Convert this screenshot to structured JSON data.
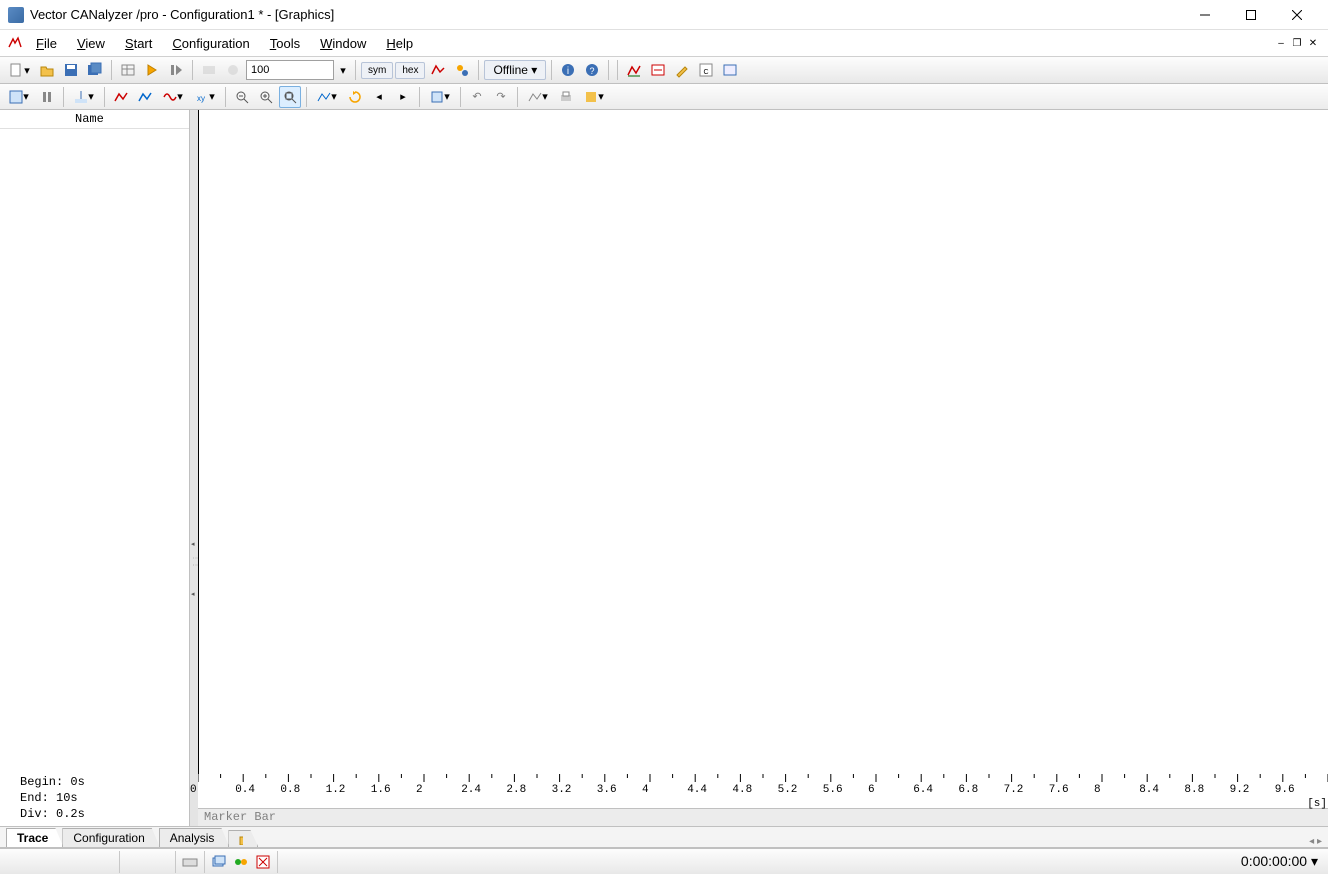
{
  "title": "Vector CANalyzer /pro  - Configuration1 * - [Graphics]",
  "menus": {
    "file": "File",
    "view": "View",
    "start": "Start",
    "configuration": "Configuration",
    "tools": "Tools",
    "window": "Window",
    "help": "Help"
  },
  "toolbar1": {
    "zoom_value": "100",
    "sym": "sym",
    "hex": "hex",
    "offline": "Offline"
  },
  "side": {
    "name_header": "Name",
    "begin": "Begin: 0s",
    "end": "End:   10s",
    "div": "Div:   0.2s"
  },
  "chart_data": {
    "type": "line",
    "series": [],
    "xlabel": "",
    "ylabel": "",
    "x_unit": "[s]",
    "x_range": [
      0,
      10
    ],
    "x_div": 0.2,
    "x_label_step": 0.4,
    "x_labels": [
      "0",
      "0.4",
      "0.8",
      "1.2",
      "1.6",
      "2",
      "2.4",
      "2.8",
      "3.2",
      "3.6",
      "4",
      "4.4",
      "4.8",
      "5.2",
      "5.6",
      "6",
      "6.4",
      "6.8",
      "7.2",
      "7.6",
      "8",
      "8.4",
      "8.8",
      "9.2",
      "9.6"
    ]
  },
  "marker_bar": "Marker Bar",
  "tabs": {
    "trace": "Trace",
    "configuration": "Configuration",
    "analysis": "Analysis"
  },
  "status": {
    "time": "0:00:00:00"
  }
}
